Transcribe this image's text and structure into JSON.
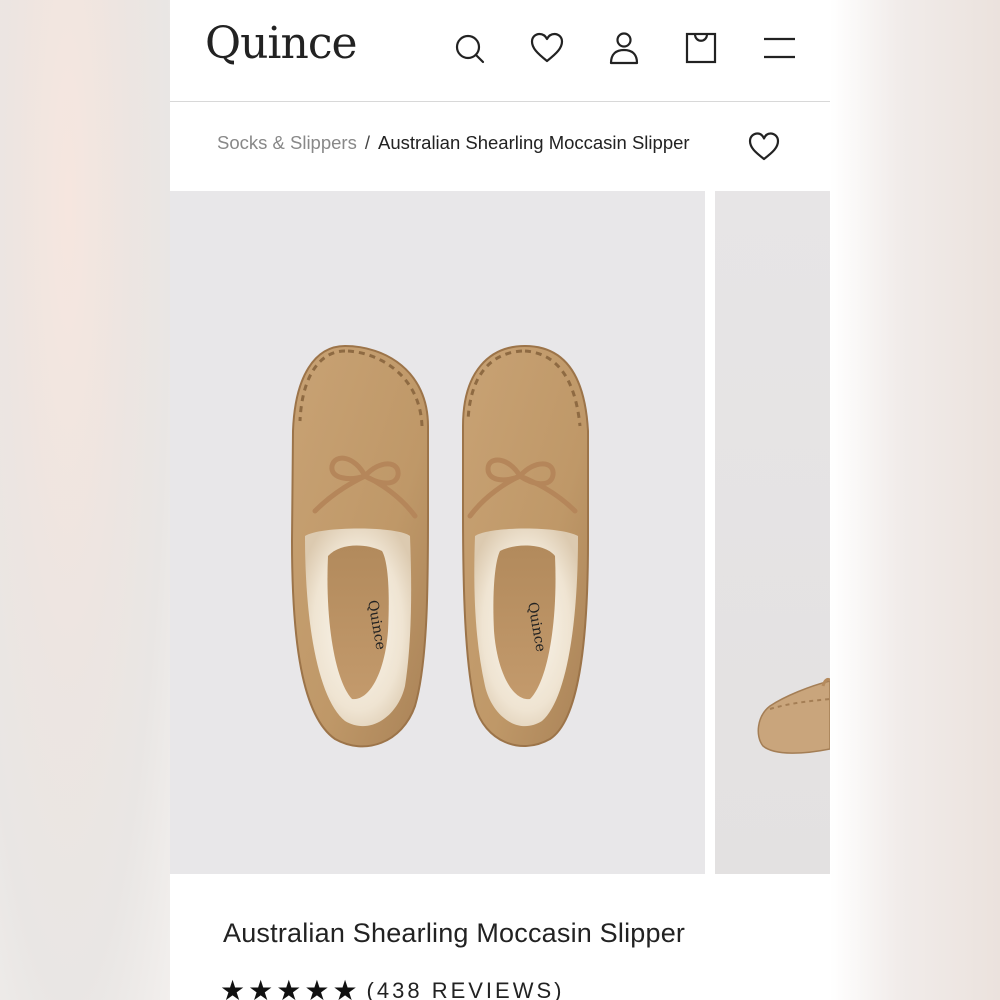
{
  "header": {
    "logo": "Quince",
    "icons": [
      "search-icon",
      "heart-icon",
      "account-icon",
      "bag-icon",
      "menu-icon"
    ]
  },
  "breadcrumb": {
    "category": "Socks & Slippers",
    "separator": "/",
    "current": "Australian Shearling Moccasin Slipper"
  },
  "gallery": {
    "insole_brand": "Quince"
  },
  "product": {
    "title": "Australian Shearling Moccasin Slipper",
    "rating": 5,
    "stars": [
      "★",
      "★",
      "★",
      "★",
      "★"
    ],
    "reviews": "(438 REVIEWS)"
  },
  "colors": {
    "suede": "#c29a6c",
    "shearling": "#f3ecdf",
    "gallery_bg": "#e8e7e9",
    "text": "#222222"
  }
}
